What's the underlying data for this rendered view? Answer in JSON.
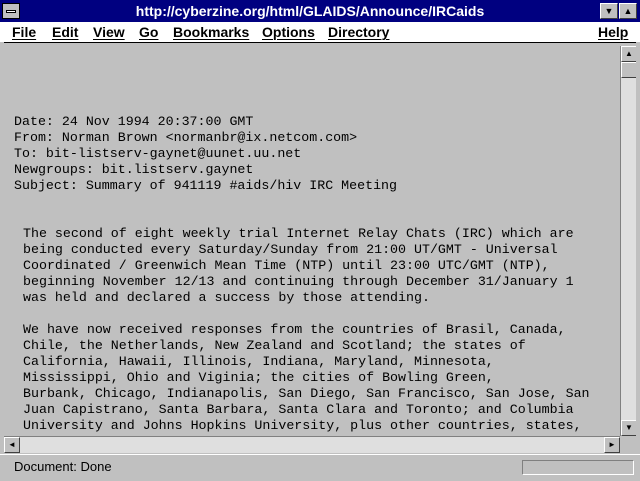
{
  "window": {
    "title": "http://cyberzine.org/html/GLAIDS/Announce/IRCaids",
    "minimize_glyph": "▼",
    "maximize_glyph": "▲"
  },
  "menu": {
    "items": [
      "File",
      "Edit",
      "View",
      "Go",
      "Bookmarks",
      "Options",
      "Directory"
    ],
    "help": "Help"
  },
  "document": {
    "header_lines": [
      "Date: 24 Nov 1994 20:37:00 GMT",
      "From: Norman Brown <normanbr@ix.netcom.com>",
      "To: bit-listserv-gaynet@uunet.uu.net",
      "Newgroups: bit.listserv.gaynet",
      "Subject: Summary of 941119 #aids/hiv IRC Meeting"
    ],
    "paragraph1": [
      "The second of eight weekly trial Internet Relay Chats (IRC) which are",
      "being conducted every Saturday/Sunday from 21:00 UT/GMT - Universal",
      "Coordinated / Greenwich Mean Time (NTP) until 23:00 UTC/GMT (NTP),",
      "beginning November 12/13 and continuing through December 31/January 1",
      "was held and declared a success by those attending."
    ],
    "paragraph2": [
      "We have now received responses from the countries of Brasil, Canada,",
      "Chile, the Netherlands, New Zealand and Scotland; the states of",
      "California, Hawaii, Illinois, Indiana, Maryland, Minnesota,",
      "Mississippi, Ohio and Viginia; the cities of Bowling Green,",
      "Burbank, Chicago, Indianapolis, San Diego, San Francisco, San Jose, San",
      "Juan Capistrano, Santa Barbara, Santa Clara and Toronto; and Columbia",
      "University and Johns Hopkins University, plus other countries, states,"
    ]
  },
  "scrollbars": {
    "up_glyph": "▲",
    "down_glyph": "▼",
    "left_glyph": "◄",
    "right_glyph": "►",
    "vertical_position": 0,
    "horizontal_position": 0
  },
  "status": {
    "text": "Document: Done",
    "progress": 0
  },
  "colors": {
    "titlebar": "#000080",
    "content_background": "#c0c0c0",
    "menubar": "#ffffff"
  }
}
